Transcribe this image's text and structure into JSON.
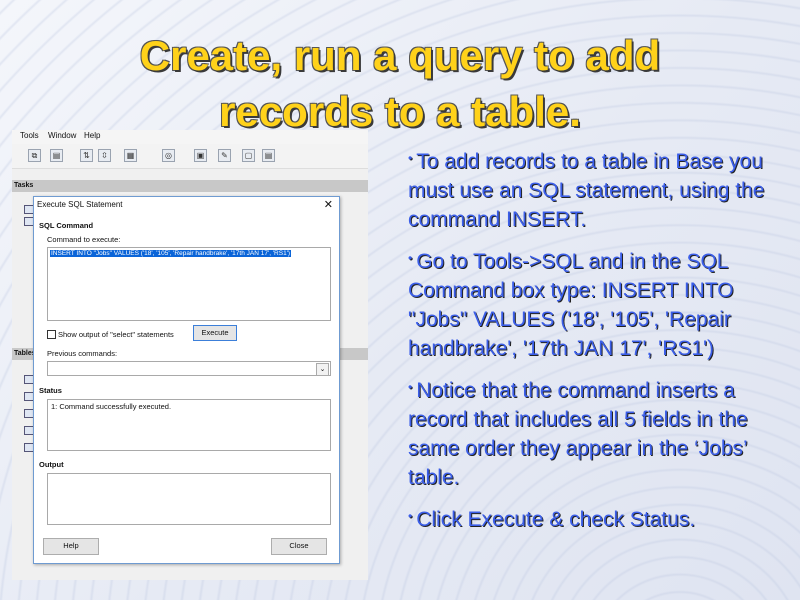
{
  "slide": {
    "title_line1": "Create, run a query to add",
    "title_line2": "records to a table."
  },
  "app": {
    "menu": [
      "Tools",
      "Window",
      "Help"
    ],
    "tasks_label": "Tasks",
    "tables_label": "Tables"
  },
  "dialog": {
    "title": "Execute SQL Statement",
    "close_glyph": "✕",
    "sql_command_label": "SQL Command",
    "command_to_execute_label": "Command to execute:",
    "command_value": "INSERT INTO \"Jobs\" VALUES ('18', '105', 'Repair handbrake', '17th JAN 17', 'RS1')",
    "show_output_label": "Show output of \"select\" statements",
    "execute_label": "Execute",
    "previous_commands_label": "Previous commands:",
    "status_label": "Status",
    "status_value": "1: Command successfully executed.",
    "output_label": "Output",
    "help_label": "Help",
    "close_label": "Close"
  },
  "bullets": [
    "To add records to a table in Base you must use an SQL statement, using the command INSERT.",
    "Go to Tools->SQL and in the SQL Command box type: INSERT INTO \"Jobs\" VALUES ('18', '105', 'Repair handbrake', '17th JAN 17', 'RS1')",
    "Notice that the command inserts a record that includes all 5 fields in the same order they appear in the ‘Jobs’ table.",
    "Click Execute & check Status."
  ],
  "colors": {
    "title": "#ffd21a",
    "bullet_text": "#3b5ee8",
    "selection": "#0a64d8"
  }
}
